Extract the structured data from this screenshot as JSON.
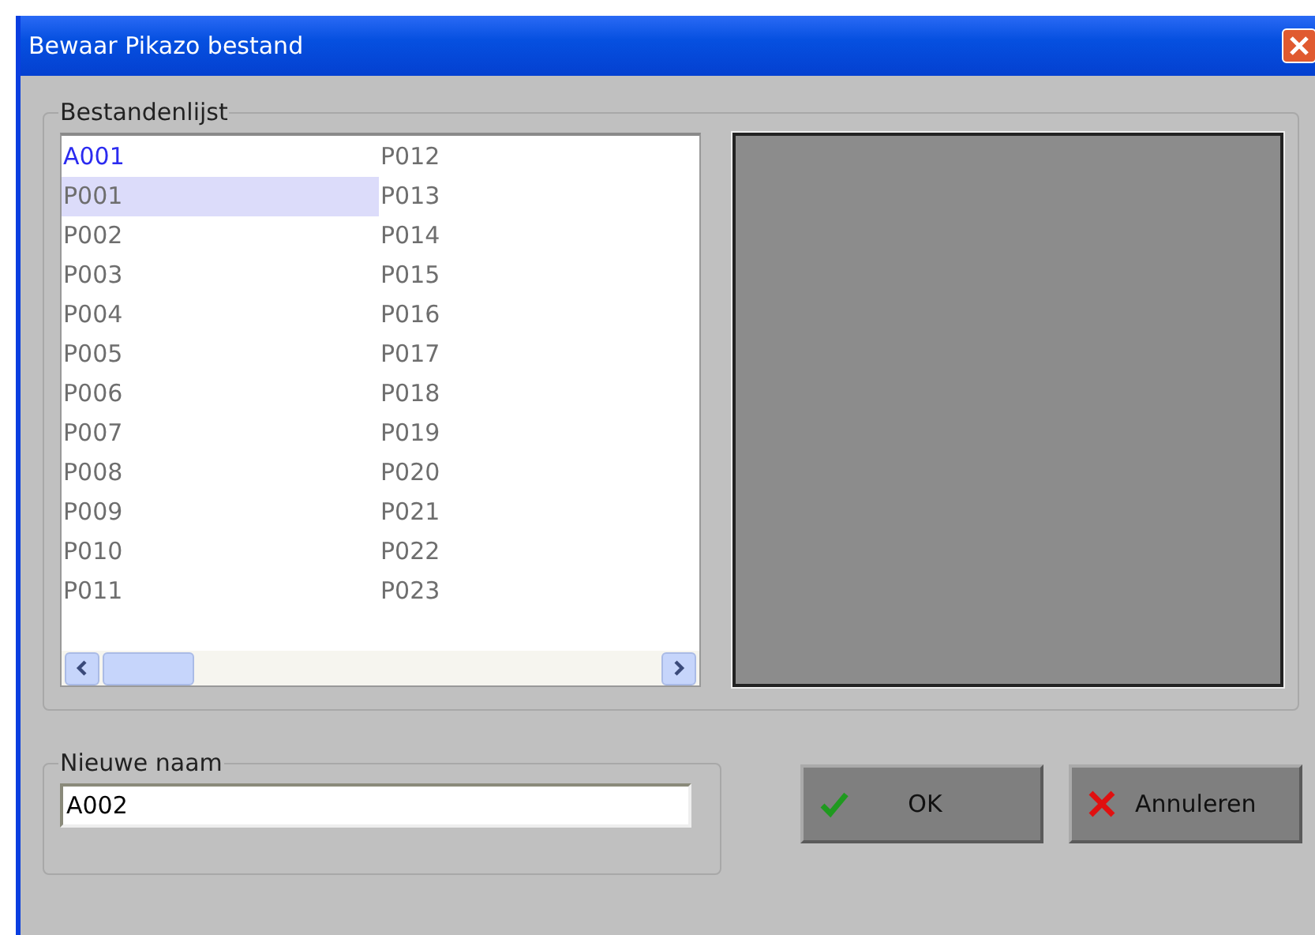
{
  "window": {
    "title": "Bewaar Pikazo bestand"
  },
  "file_list": {
    "label": "Bestandenlijst",
    "items": [
      {
        "name": "A001",
        "color": "#2b2bf0",
        "selected": false
      },
      {
        "name": "P001",
        "color": "#6e6e6e",
        "selected": true
      },
      {
        "name": "P002",
        "color": "#6e6e6e",
        "selected": false
      },
      {
        "name": "P003",
        "color": "#6e6e6e",
        "selected": false
      },
      {
        "name": "P004",
        "color": "#6e6e6e",
        "selected": false
      },
      {
        "name": "P005",
        "color": "#6e6e6e",
        "selected": false
      },
      {
        "name": "P006",
        "color": "#6e6e6e",
        "selected": false
      },
      {
        "name": "P007",
        "color": "#6e6e6e",
        "selected": false
      },
      {
        "name": "P008",
        "color": "#6e6e6e",
        "selected": false
      },
      {
        "name": "P009",
        "color": "#6e6e6e",
        "selected": false
      },
      {
        "name": "P010",
        "color": "#6e6e6e",
        "selected": false
      },
      {
        "name": "P011",
        "color": "#6e6e6e",
        "selected": false
      },
      {
        "name": "P012",
        "color": "#6e6e6e",
        "selected": false
      },
      {
        "name": "P013",
        "color": "#6e6e6e",
        "selected": false
      },
      {
        "name": "P014",
        "color": "#6e6e6e",
        "selected": false
      },
      {
        "name": "P015",
        "color": "#6e6e6e",
        "selected": false
      },
      {
        "name": "P016",
        "color": "#6e6e6e",
        "selected": false
      },
      {
        "name": "P017",
        "color": "#6e6e6e",
        "selected": false
      },
      {
        "name": "P018",
        "color": "#6e6e6e",
        "selected": false
      },
      {
        "name": "P019",
        "color": "#6e6e6e",
        "selected": false
      },
      {
        "name": "P020",
        "color": "#6e6e6e",
        "selected": false
      },
      {
        "name": "P021",
        "color": "#6e6e6e",
        "selected": false
      },
      {
        "name": "P022",
        "color": "#6e6e6e",
        "selected": false
      },
      {
        "name": "P023",
        "color": "#6e6e6e",
        "selected": false
      }
    ]
  },
  "new_name": {
    "label": "Nieuwe naam",
    "value": "A002"
  },
  "buttons": [
    {
      "label": "OK",
      "kind": "ok"
    },
    {
      "label": "Annuleren",
      "kind": "cancel"
    }
  ]
}
